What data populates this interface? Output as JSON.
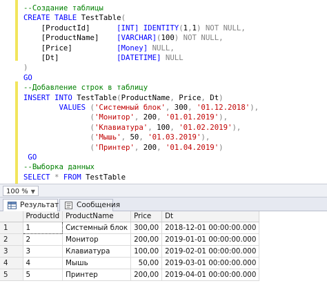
{
  "editor": {
    "lines": [
      [
        {
          "t": "--Создание таблицы",
          "c": "cm"
        }
      ],
      [
        {
          "t": "CREATE TABLE ",
          "c": "kw"
        },
        {
          "t": "TestTable",
          "c": "tx"
        },
        {
          "t": "(",
          "c": "gr"
        }
      ],
      [
        {
          "t": "    [ProductId]      ",
          "c": "tx"
        },
        {
          "t": "[INT] ",
          "c": "kw"
        },
        {
          "t": "IDENTITY",
          "c": "kw"
        },
        {
          "t": "(",
          "c": "gr"
        },
        {
          "t": "1",
          "c": "tx"
        },
        {
          "t": ",",
          "c": "gr"
        },
        {
          "t": "1",
          "c": "tx"
        },
        {
          "t": ") ",
          "c": "gr"
        },
        {
          "t": "NOT NULL",
          "c": "gr"
        },
        {
          "t": ",",
          "c": "gr"
        }
      ],
      [
        {
          "t": "    [ProductName]    ",
          "c": "tx"
        },
        {
          "t": "[VARCHAR]",
          "c": "kw"
        },
        {
          "t": "(",
          "c": "gr"
        },
        {
          "t": "100",
          "c": "tx"
        },
        {
          "t": ") ",
          "c": "gr"
        },
        {
          "t": "NOT NULL",
          "c": "gr"
        },
        {
          "t": ",",
          "c": "gr"
        }
      ],
      [
        {
          "t": "    [Price]          ",
          "c": "tx"
        },
        {
          "t": "[Money] ",
          "c": "kw"
        },
        {
          "t": "NULL",
          "c": "gr"
        },
        {
          "t": ",",
          "c": "gr"
        }
      ],
      [
        {
          "t": "    [Dt]             ",
          "c": "tx"
        },
        {
          "t": "[DATETIME] ",
          "c": "kw"
        },
        {
          "t": "NULL",
          "c": "gr"
        }
      ],
      [
        {
          "t": ")",
          "c": "gr"
        }
      ],
      [
        {
          "t": "GO",
          "c": "kw"
        }
      ],
      [
        {
          "t": "--Добавление строк в таблицу",
          "c": "cm"
        }
      ],
      [
        {
          "t": "INSERT INTO ",
          "c": "kw"
        },
        {
          "t": "TestTable",
          "c": "tx"
        },
        {
          "t": "(",
          "c": "gr"
        },
        {
          "t": "ProductName",
          "c": "tx"
        },
        {
          "t": ", ",
          "c": "gr"
        },
        {
          "t": "Price",
          "c": "tx"
        },
        {
          "t": ", ",
          "c": "gr"
        },
        {
          "t": "Dt",
          "c": "tx"
        },
        {
          "t": ")",
          "c": "gr"
        }
      ],
      [
        {
          "t": "        VALUES ",
          "c": "kw"
        },
        {
          "t": "(",
          "c": "gr"
        },
        {
          "t": "'Системный блок'",
          "c": "st"
        },
        {
          "t": ", ",
          "c": "gr"
        },
        {
          "t": "300",
          "c": "tx"
        },
        {
          "t": ", ",
          "c": "gr"
        },
        {
          "t": "'01.12.2018'",
          "c": "st"
        },
        {
          "t": "),",
          "c": "gr"
        }
      ],
      [
        {
          "t": "               ",
          "c": "tx"
        },
        {
          "t": "(",
          "c": "gr"
        },
        {
          "t": "'Монитор'",
          "c": "st"
        },
        {
          "t": ", ",
          "c": "gr"
        },
        {
          "t": "200",
          "c": "tx"
        },
        {
          "t": ", ",
          "c": "gr"
        },
        {
          "t": "'01.01.2019'",
          "c": "st"
        },
        {
          "t": "),",
          "c": "gr"
        }
      ],
      [
        {
          "t": "               ",
          "c": "tx"
        },
        {
          "t": "(",
          "c": "gr"
        },
        {
          "t": "'Клавиатура'",
          "c": "st"
        },
        {
          "t": ", ",
          "c": "gr"
        },
        {
          "t": "100",
          "c": "tx"
        },
        {
          "t": ", ",
          "c": "gr"
        },
        {
          "t": "'01.02.2019'",
          "c": "st"
        },
        {
          "t": "),",
          "c": "gr"
        }
      ],
      [
        {
          "t": "               ",
          "c": "tx"
        },
        {
          "t": "(",
          "c": "gr"
        },
        {
          "t": "'Мышь'",
          "c": "st"
        },
        {
          "t": ", ",
          "c": "gr"
        },
        {
          "t": "50",
          "c": "tx"
        },
        {
          "t": ", ",
          "c": "gr"
        },
        {
          "t": "'01.03.2019'",
          "c": "st"
        },
        {
          "t": "),",
          "c": "gr"
        }
      ],
      [
        {
          "t": "               ",
          "c": "tx"
        },
        {
          "t": "(",
          "c": "gr"
        },
        {
          "t": "'Принтер'",
          "c": "st"
        },
        {
          "t": ", ",
          "c": "gr"
        },
        {
          "t": "200",
          "c": "tx"
        },
        {
          "t": ", ",
          "c": "gr"
        },
        {
          "t": "'01.04.2019'",
          "c": "st"
        },
        {
          "t": ")",
          "c": "gr"
        }
      ],
      [
        {
          "t": " GO",
          "c": "kw"
        }
      ],
      [
        {
          "t": "--Выборка данных",
          "c": "cm"
        }
      ],
      [
        {
          "t": "SELECT ",
          "c": "kw"
        },
        {
          "t": "* ",
          "c": "gr"
        },
        {
          "t": "FROM ",
          "c": "kw"
        },
        {
          "t": "TestTable",
          "c": "tx"
        }
      ]
    ]
  },
  "zoom": {
    "value": "100 %"
  },
  "tabs": [
    {
      "label": "Результаты",
      "icon": "grid-results-icon",
      "active": true
    },
    {
      "label": "Сообщения",
      "icon": "messages-icon",
      "active": false
    }
  ],
  "results": {
    "columns": [
      "ProductId",
      "ProductName",
      "Price",
      "Dt"
    ],
    "rows": [
      {
        "n": "1",
        "cells": [
          "1",
          "Системный блок",
          "300,00",
          "2018-12-01 00:00:00.000"
        ]
      },
      {
        "n": "2",
        "cells": [
          "2",
          "Монитор",
          "200,00",
          "2019-01-01 00:00:00.000"
        ]
      },
      {
        "n": "3",
        "cells": [
          "3",
          "Клавиатура",
          "100,00",
          "2019-02-01 00:00:00.000"
        ]
      },
      {
        "n": "4",
        "cells": [
          "4",
          "Мышь",
          "50,00",
          "2019-03-01 00:00:00.000"
        ]
      },
      {
        "n": "5",
        "cells": [
          "5",
          "Принтер",
          "200,00",
          "2019-04-01 00:00:00.000"
        ]
      }
    ]
  },
  "colors": {
    "comment": "#008000",
    "keyword": "#0000ff",
    "string": "#c00000",
    "gutter": "#f2e55c"
  }
}
